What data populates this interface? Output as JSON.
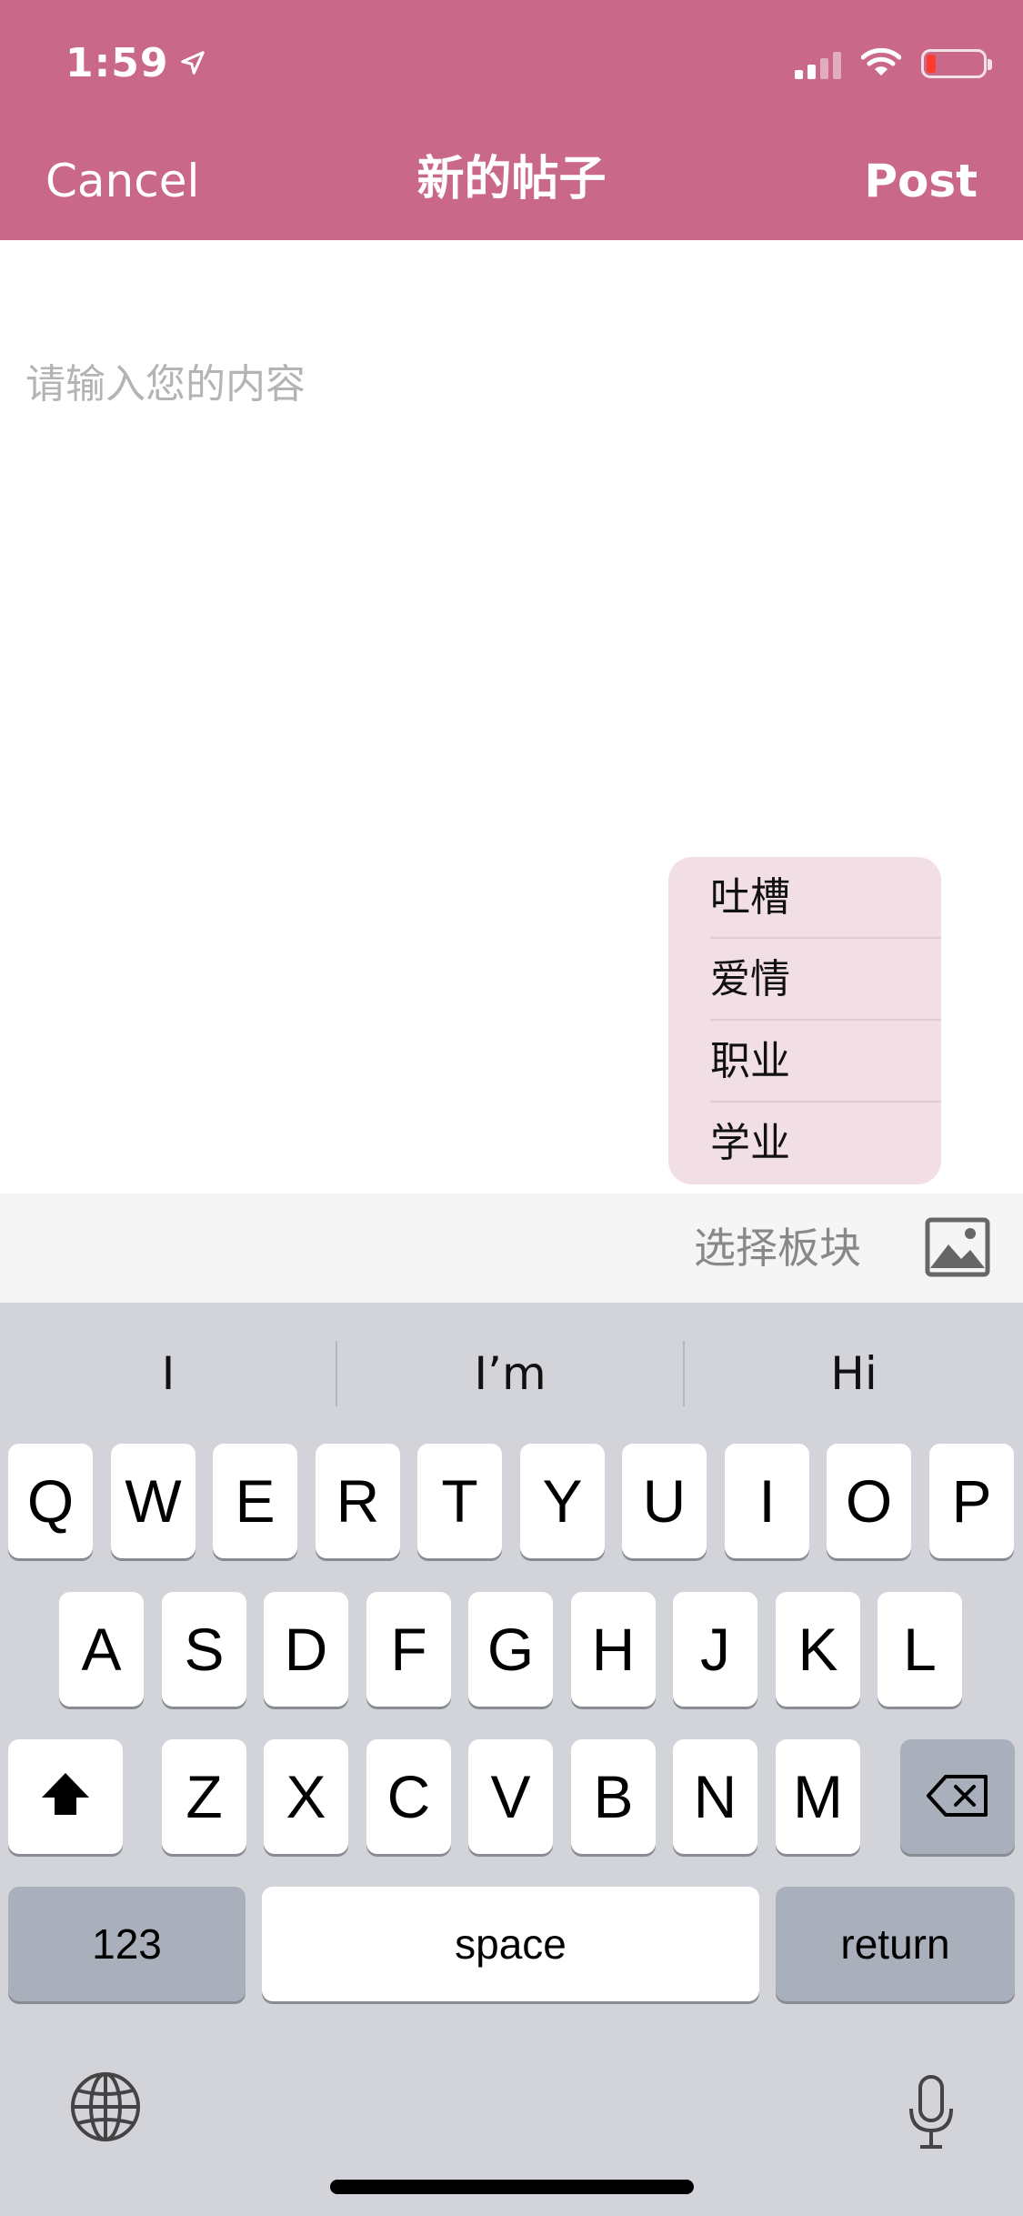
{
  "status_bar": {
    "time": "1:59",
    "icons": [
      "location-arrow-icon",
      "cellular-signal-icon",
      "wifi-icon",
      "battery-low-icon"
    ],
    "battery_color": "#ff3b30"
  },
  "nav": {
    "cancel_label": "Cancel",
    "title": "新的帖子",
    "post_label": "Post",
    "background_color": "#c96889"
  },
  "editor": {
    "placeholder": "请输入您的内容",
    "value": ""
  },
  "section_menu": {
    "items": [
      "吐槽",
      "爱情",
      "职业",
      "学业"
    ],
    "background_color": "#f2dfe6"
  },
  "toolbar": {
    "select_section_label": "选择板块",
    "image_icon": "image-icon"
  },
  "keyboard": {
    "suggestions": [
      "I",
      "I’m",
      "Hi"
    ],
    "row1": [
      "Q",
      "W",
      "E",
      "R",
      "T",
      "Y",
      "U",
      "I",
      "O",
      "P"
    ],
    "row2": [
      "A",
      "S",
      "D",
      "F",
      "G",
      "H",
      "J",
      "K",
      "L"
    ],
    "row3": [
      "Z",
      "X",
      "C",
      "V",
      "B",
      "N",
      "M"
    ],
    "numbers_label": "123",
    "space_label": "space",
    "return_label": "return",
    "icons": [
      "shift-icon",
      "backspace-icon",
      "globe-icon",
      "microphone-icon"
    ]
  }
}
